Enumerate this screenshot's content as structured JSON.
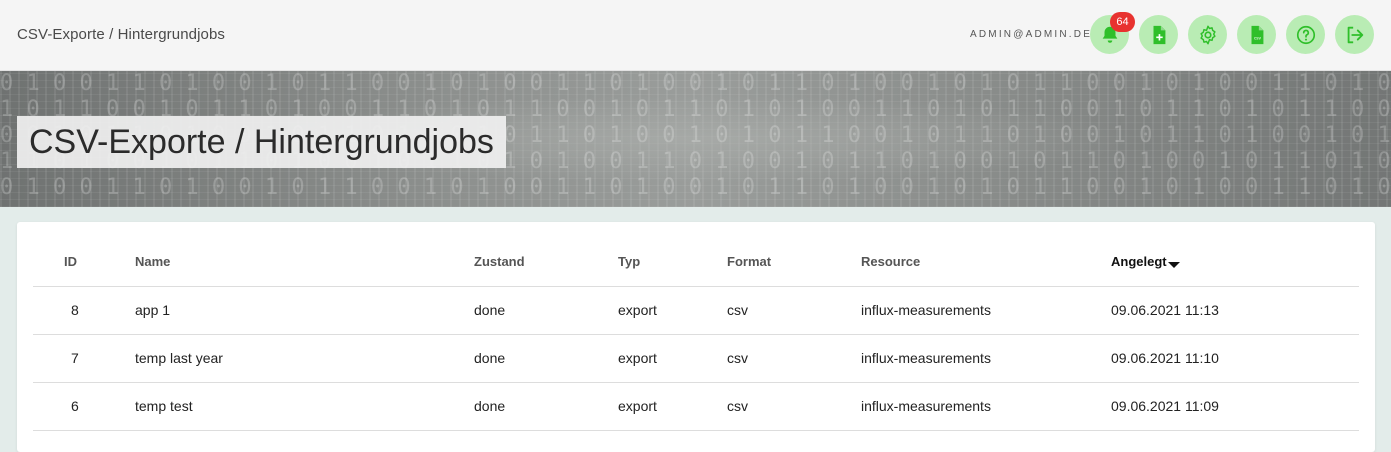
{
  "header": {
    "breadcrumb": "CSV-Exporte / Hintergrundjobs",
    "user_email": "ADMIN@ADMIN.DE",
    "notification_count": "64",
    "icons": [
      "bell-icon",
      "file-add-icon",
      "gear-icon",
      "csv-file-icon",
      "help-icon",
      "logout-icon"
    ],
    "accent_color": "#2fbf2a",
    "button_bg": "#b9ecb4"
  },
  "banner": {
    "title": "CSV-Exporte / Hintergrundjobs"
  },
  "table": {
    "columns": [
      "ID",
      "Name",
      "Zustand",
      "Typ",
      "Format",
      "Resource",
      "Angelegt"
    ],
    "sorted_column": "Angelegt",
    "rows": [
      {
        "id": "8",
        "name": "app 1",
        "state": "done",
        "type": "export",
        "format": "csv",
        "resource": "influx-measurements",
        "created": "09.06.2021 11:13"
      },
      {
        "id": "7",
        "name": "temp last year",
        "state": "done",
        "type": "export",
        "format": "csv",
        "resource": "influx-measurements",
        "created": "09.06.2021 11:10"
      },
      {
        "id": "6",
        "name": "temp test",
        "state": "done",
        "type": "export",
        "format": "csv",
        "resource": "influx-measurements",
        "created": "09.06.2021 11:09"
      }
    ]
  }
}
